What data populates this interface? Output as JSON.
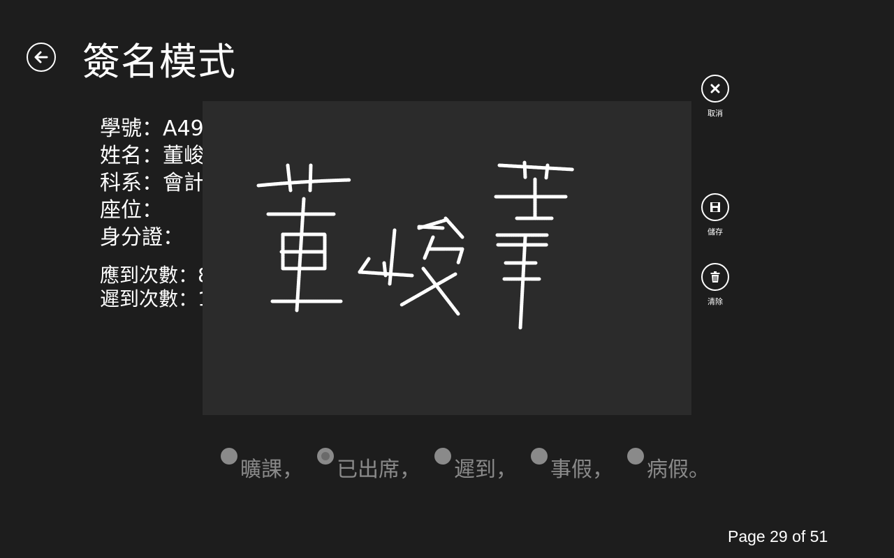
{
  "header": {
    "title": "簽名模式",
    "back_icon": "arrow-left-icon"
  },
  "student": {
    "id_label": "學號：",
    "id_value": "A49",
    "name_label": "姓名：",
    "name_value": "董峻",
    "dept_label": "科系：",
    "dept_value": "會計",
    "seat_label": "座位：",
    "seat_value": "",
    "idcard_label": "身分證：",
    "idcard_value": ""
  },
  "attendance": {
    "required_label": "應到次數：",
    "required_value": "8",
    "late_label": "遲到次數：",
    "late_value": "1"
  },
  "signature": {
    "icon": "handwritten-signature"
  },
  "app_bar": {
    "cancel": {
      "label": "取消",
      "icon": "close-icon"
    },
    "save": {
      "label": "儲存",
      "icon": "floppy-disk-icon"
    },
    "clear": {
      "label": "清除",
      "icon": "trash-icon"
    }
  },
  "status_options": [
    {
      "label": "曠課，",
      "selected": false
    },
    {
      "label": "已出席，",
      "selected": true
    },
    {
      "label": "遲到，",
      "selected": false
    },
    {
      "label": "事假，",
      "selected": false
    },
    {
      "label": "病假。",
      "selected": false
    }
  ],
  "footer": {
    "page_indicator": "Page 29 of 51"
  },
  "colors": {
    "background": "#1d1d1d",
    "panel": "#2b2b2b",
    "text": "#ffffff",
    "muted": "#8a8a8a"
  }
}
